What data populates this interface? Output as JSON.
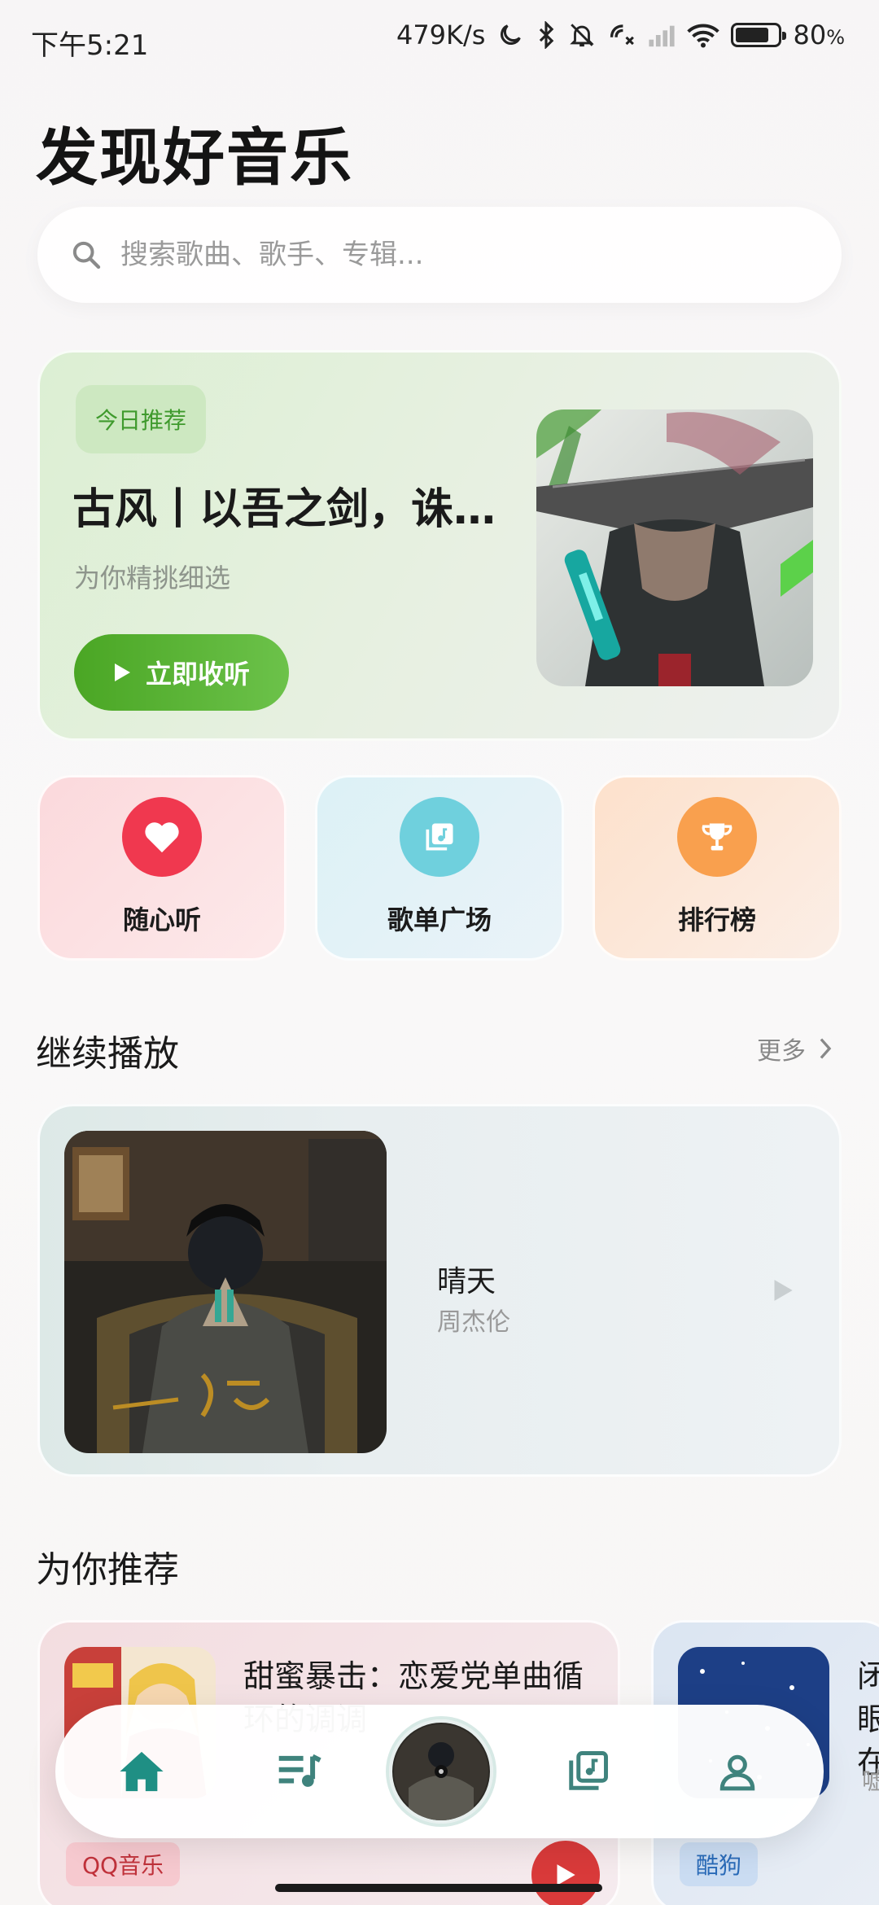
{
  "status_bar": {
    "time": "下午5:21",
    "net_speed": "479K/s",
    "battery": "80",
    "battery_unit": "%",
    "battery_level": 0.8,
    "icons": [
      "moon-icon",
      "bluetooth-icon",
      "mute-bell-icon",
      "call-off-icon",
      "signal-icon",
      "wifi-icon",
      "battery-icon"
    ]
  },
  "page_title": "发现好音乐",
  "search": {
    "placeholder": "搜索歌曲、歌手、专辑..."
  },
  "daily": {
    "tag": "今日推荐",
    "title": "古风丨以吾之剑，诛…",
    "subtitle": "为你精挑细选",
    "button": "立即收听"
  },
  "quick_actions": [
    {
      "label": "随心听",
      "icon": "heart-icon",
      "color": "#f0384f"
    },
    {
      "label": "歌单广场",
      "icon": "playlist-icon",
      "color": "#6fd0dd"
    },
    {
      "label": "排行榜",
      "icon": "trophy-icon",
      "color": "#f9a04e"
    }
  ],
  "continue_section": {
    "title": "继续播放",
    "more": "更多",
    "song": "晴天",
    "artist": "周杰伦"
  },
  "recommend_section": {
    "title": "为你推荐",
    "cards": [
      {
        "title": "甜蜜暴击：恋爱党单曲循环的调调",
        "source": "QQ音乐"
      },
      {
        "title": "闭眼在",
        "sub": "嘘",
        "source": "酷狗"
      }
    ]
  },
  "bottom_nav": {
    "items": [
      "home-icon",
      "playlist-queue-icon",
      "now-playing-disc",
      "library-icon",
      "profile-icon"
    ],
    "accent": "#1f8f84"
  }
}
